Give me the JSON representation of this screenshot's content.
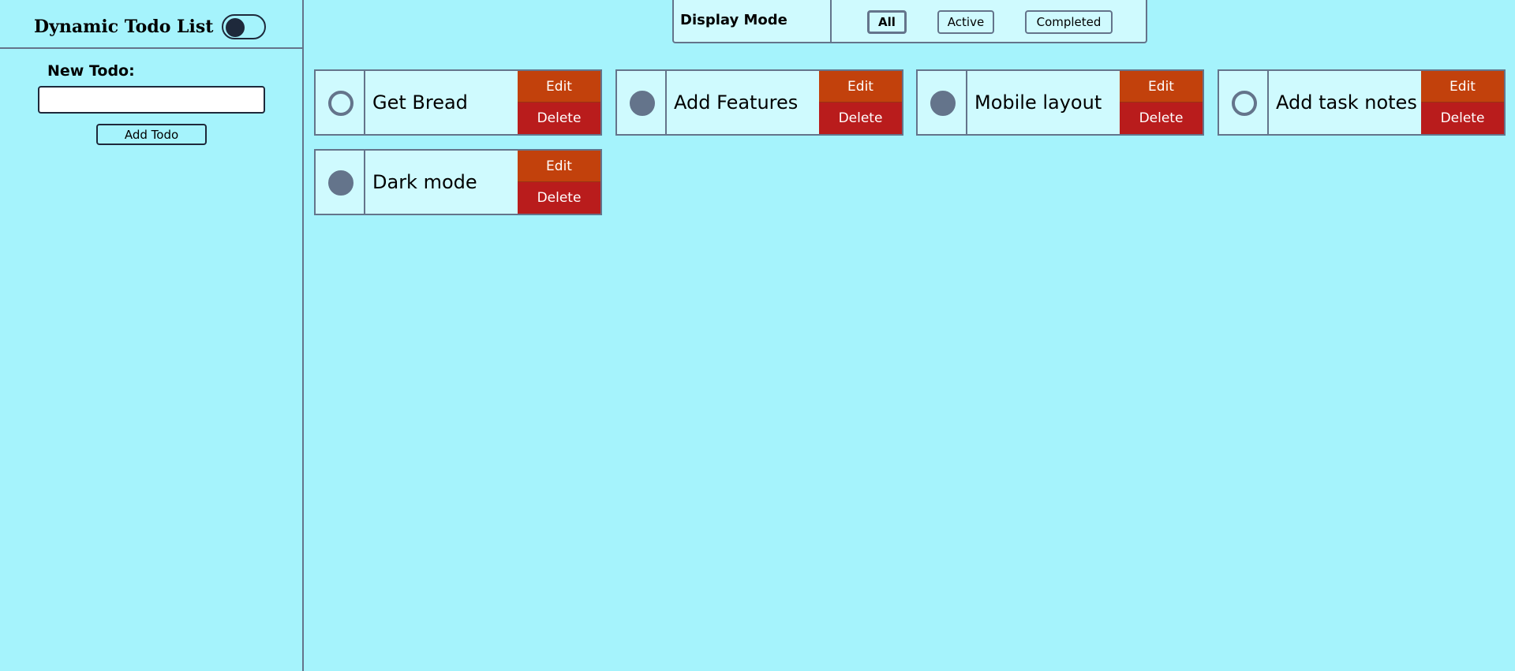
{
  "sidebar": {
    "title": "Dynamic Todo List",
    "new_todo_label": "New Todo:",
    "input_value": "",
    "add_button_label": "Add Todo"
  },
  "display_mode": {
    "label": "Display Mode",
    "filters": [
      {
        "label": "All",
        "selected": true
      },
      {
        "label": "Active",
        "selected": false
      },
      {
        "label": "Completed",
        "selected": false
      }
    ]
  },
  "todos": [
    {
      "text": "Get Bread",
      "completed": false,
      "edit_label": "Edit",
      "delete_label": "Delete"
    },
    {
      "text": "Add Features",
      "completed": true,
      "edit_label": "Edit",
      "delete_label": "Delete"
    },
    {
      "text": "Mobile layout",
      "completed": true,
      "edit_label": "Edit",
      "delete_label": "Delete"
    },
    {
      "text": "Add task notes",
      "completed": false,
      "edit_label": "Edit",
      "delete_label": "Delete"
    },
    {
      "text": "Dark mode",
      "completed": true,
      "edit_label": "Edit",
      "delete_label": "Delete"
    }
  ],
  "colors": {
    "background": "#a5f3fc",
    "card": "#cffafe",
    "border": "#64748b",
    "edit": "#c2410c",
    "delete": "#b91c1c"
  }
}
